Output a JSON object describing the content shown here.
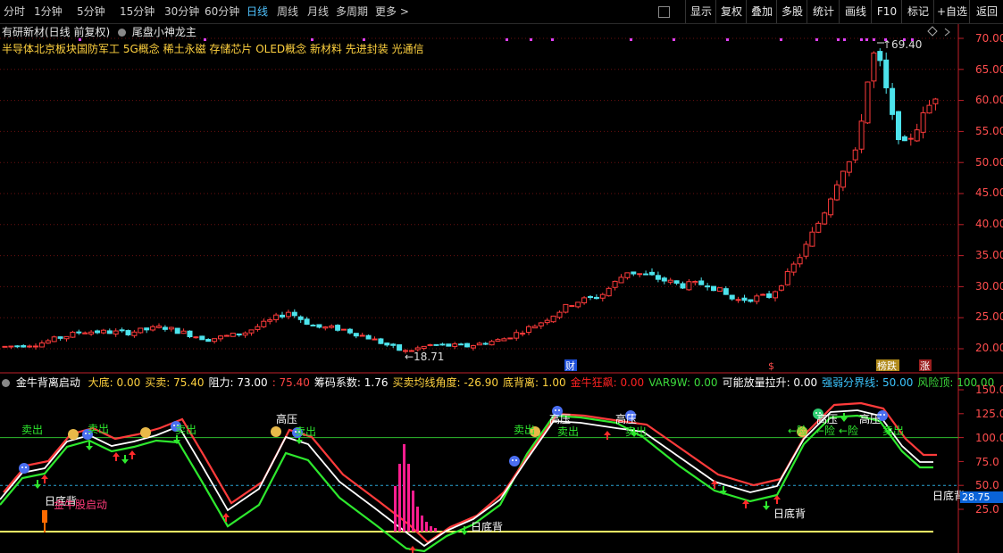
{
  "toolbar": {
    "timeframes": [
      "分时",
      "1分钟",
      "5分钟",
      "15分钟",
      "30分钟",
      "60分钟",
      "日线",
      "周线",
      "月线",
      "多周期",
      "更多 >"
    ],
    "active_timeframe": "日线",
    "right_buttons": [
      "显示",
      "复权",
      "叠加",
      "多股",
      "统计",
      "画线",
      "F10",
      "标记",
      "+自选",
      "返回"
    ]
  },
  "main_chart": {
    "title": "有研新材(日线 前复权)",
    "indicator_name": "尾盘小神龙主",
    "concepts": "半导体北京板块国防军工 5G概念 稀土永磁 存储芯片 OLED概念 新材料 先进封装 光通信",
    "high_label": "69.40",
    "low_label": "18.71",
    "price_axis": [
      "70.00",
      "65.00",
      "60.00",
      "55.00",
      "50.00",
      "45.00",
      "40.00",
      "35.00",
      "30.00",
      "25.00",
      "20.00"
    ],
    "event_badges": [
      "财",
      "$",
      "榜跌",
      "涨"
    ]
  },
  "indicator_panel": {
    "name": "金牛背离启动",
    "values": [
      {
        "label": "大底:",
        "value": "0.00",
        "color": "#ffd23f"
      },
      {
        "label": "买卖:",
        "value": "75.40",
        "color": "#ffd23f"
      },
      {
        "label": "阻力:",
        "value": "73.00",
        "color": "#ffffff"
      },
      {
        "label": ":",
        "value": "75.40",
        "color": "#ff4444"
      },
      {
        "label": "筹码系数:",
        "value": "1.76",
        "color": "#ffffff"
      },
      {
        "label": "买卖均线角度:",
        "value": "-26.90",
        "color": "#ffd23f"
      },
      {
        "label": "底背离:",
        "value": "1.00",
        "color": "#ffd23f"
      },
      {
        "label": "金牛狂飙:",
        "value": "0.00",
        "color": "#ff2222"
      },
      {
        "label": "VAR9W:",
        "value": "0.00",
        "color": "#3ddc3d"
      },
      {
        "label": "可能放量拉升:",
        "value": "0.00",
        "color": "#ffffff"
      },
      {
        "label": "强弱分界线:",
        "value": "50.00",
        "color": "#3cc6ff"
      },
      {
        "label": "风险顶:",
        "value": "100.00",
        "color": "#3ddc3d"
      }
    ],
    "axis": [
      "150.0",
      "125.0",
      "100.0",
      "75.0",
      "50.0",
      "25.0"
    ],
    "current_value": "28.75",
    "annotations": {
      "sell": "卖出",
      "high_pressure": "高压",
      "bottom_div": "日底背",
      "jiniu_start": "金牛股启动",
      "risk": "←险"
    }
  },
  "colors": {
    "up": "#ff3b3b",
    "down": "#4de3ec",
    "green": "#2ee82e",
    "white": "#ffffff",
    "yellow": "#ffff66",
    "magenta": "#ff1d8f"
  }
}
